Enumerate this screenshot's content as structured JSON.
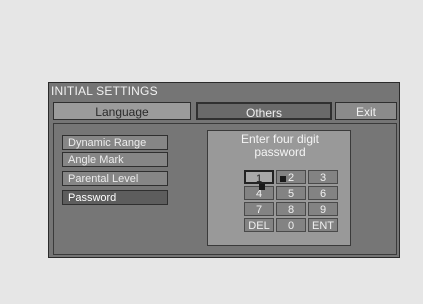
{
  "window": {
    "title": "INITIAL SETTINGS"
  },
  "tabs": [
    {
      "label": "Language"
    },
    {
      "label": "Others"
    },
    {
      "label": "Exit"
    }
  ],
  "menu": {
    "items": [
      {
        "label": "Dynamic Range"
      },
      {
        "label": "Angle Mark"
      },
      {
        "label": "Parental Level"
      },
      {
        "label": "Password"
      }
    ],
    "selected": "Password"
  },
  "password_panel": {
    "prompt_line1": "Enter four digit",
    "prompt_line2": "password"
  },
  "keypad": {
    "keys": [
      "1",
      "2",
      "3",
      "4",
      "5",
      "6",
      "7",
      "8",
      "9",
      "DEL",
      "0",
      "ENT"
    ],
    "selected": "1"
  }
}
